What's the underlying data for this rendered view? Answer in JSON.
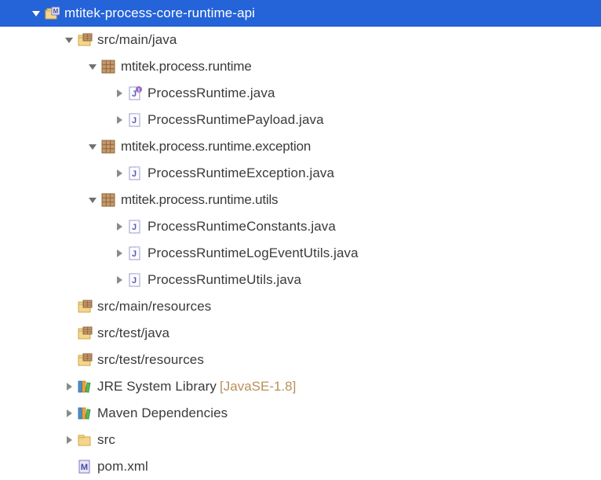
{
  "project": {
    "name": "mtitek-process-core-runtime-api"
  },
  "srcMainJava": "src/main/java",
  "packages": {
    "runtime": "mtitek.process.runtime",
    "exception": "mtitek.process.runtime.exception",
    "utils": "mtitek.process.runtime.utils"
  },
  "files": {
    "processRuntime": "ProcessRuntime.java",
    "processRuntimePayload": "ProcessRuntimePayload.java",
    "processRuntimeException": "ProcessRuntimeException.java",
    "processRuntimeConstants": "ProcessRuntimeConstants.java",
    "processRuntimeLogEventUtils": "ProcessRuntimeLogEventUtils.java",
    "processRuntimeUtils": "ProcessRuntimeUtils.java"
  },
  "folders": {
    "srcMainResources": "src/main/resources",
    "srcTestJava": "src/test/java",
    "srcTestResources": "src/test/resources",
    "src": "src"
  },
  "libraries": {
    "jre": "JRE System Library",
    "jreVersion": "[JavaSE-1.8]",
    "maven": "Maven Dependencies"
  },
  "pom": "pom.xml",
  "indent": 30,
  "baseIndent": 40
}
